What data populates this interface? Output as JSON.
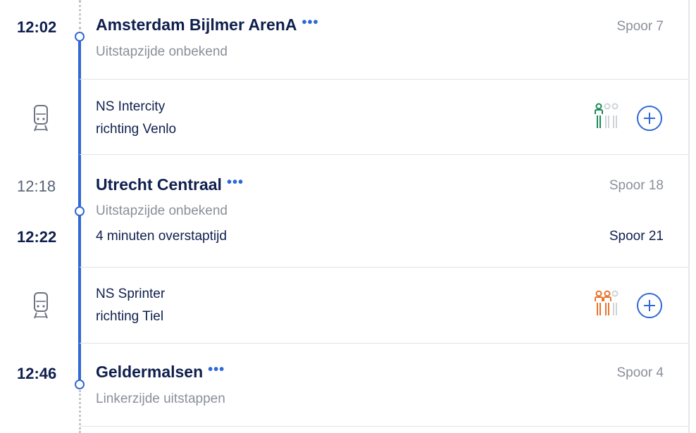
{
  "stops": [
    {
      "time": "12:02",
      "name": "Amsterdam Bijlmer ArenA",
      "platform": "Spoor 7",
      "note": "Uitstapzijde onbekend",
      "more": "•••"
    },
    {
      "arrival_time": "12:18",
      "name": "Utrecht Centraal",
      "arrival_platform": "Spoor 18",
      "note": "Uitstapzijde onbekend",
      "departure_time": "12:22",
      "transfer": "4 minuten overstaptijd",
      "departure_platform": "Spoor 21",
      "more": "•••"
    },
    {
      "time": "12:46",
      "name": "Geldermalsen",
      "platform": "Spoor 4",
      "note": "Linkerzijde uitstappen",
      "more": "•••"
    }
  ],
  "legs": [
    {
      "train": "NS Intercity",
      "direction": "richting Venlo",
      "icon": "train-icon",
      "crowd_icon": "crowd-low-icon",
      "crowd_level": 1,
      "crowd_color": "#1a8a5b"
    },
    {
      "train": "NS Sprinter",
      "direction": "richting Tiel",
      "icon": "train-icon",
      "crowd_icon": "crowd-medium-icon",
      "crowd_level": 2,
      "crowd_color": "#e8742c"
    }
  ],
  "colors": {
    "accent": "#2e68d6",
    "text": "#0f1f4d",
    "muted": "#8a8f99"
  }
}
